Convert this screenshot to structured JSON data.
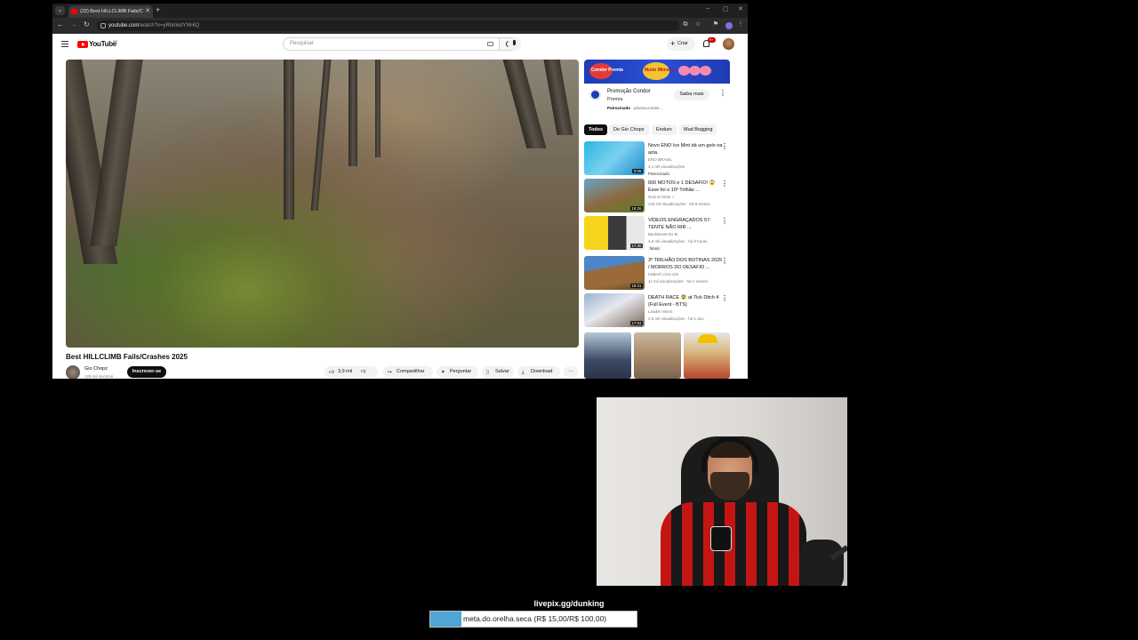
{
  "browser": {
    "tab_title": "(22) Best HILLCLIMB Fails/C",
    "new_tab": "+",
    "url_host": "youtube.com",
    "url_path": "/watch?v=yRbmkdYNHiQ",
    "window_controls": [
      "–",
      "▢",
      "✕"
    ]
  },
  "youtube": {
    "logo_text": "YouTube",
    "region": "BR",
    "search_placeholder": "Pesquisar",
    "create_label": "Criar",
    "notifications_badge": "9+"
  },
  "video": {
    "title": "Best HILLCLIMB Fails/Crashes 2025",
    "channel": "Gio Chopz",
    "subscribers": "129 mil inscritos",
    "subscribe_label": "Inscrever-se",
    "likes": "3,9 mil",
    "share_label": "Compartilhar",
    "ask_label": "Perguntar",
    "save_label": "Salvar",
    "download_label": "Download",
    "more": "···"
  },
  "ad": {
    "banner_text_1": "Condor Premia",
    "banner_text_2": "Muito Mimoso",
    "name": "Promoção Condor",
    "sub": "Premia",
    "sponsored": "Patrocinado",
    "domain": "· premia.condor...",
    "cta": "Saiba mais"
  },
  "chips": [
    "Todos",
    "De Gio Chopz",
    "Enduro",
    "Mud Bogging"
  ],
  "recommendations": [
    {
      "title": "Novo ENO Ice Mint dá um gelo na azia.",
      "channel": "ENO BRASIL",
      "meta": "4,1 mil visualizações",
      "badge": "Patrocinado",
      "duration": "0:06"
    },
    {
      "title": "600 MOTOS e 1 DESAFIO! 😱 Esse foi o 10º Trilhão ...",
      "channel": "Nois te trinte ✓",
      "meta": "142 mil visualizações · há 8 meses",
      "badge": "",
      "duration": "19:26"
    },
    {
      "title": "VÍDEOS ENGRAÇADOS 57: TENTE NÃO RIR ...",
      "channel": "Backstreet Do Bi",
      "meta": "4,9 mil visualizações · há 6 horas",
      "badge": "Novo",
      "duration": "17:30"
    },
    {
      "title": "3º TRILHÃO DOS BOTINAS 2025 / MORROS DO DESAFIO ...",
      "channel": "Haberé Lima 222",
      "meta": "11 mil visualizações · há 2 meses",
      "badge": "",
      "duration": "18:31"
    },
    {
      "title": "DEATH RACE 😨 at Tick Ditch 4 (Full Event - BTS)",
      "channel": "Leader Vision",
      "meta": "2,6 mil visualizações · há 1 ano",
      "badge": "",
      "duration": "17:04"
    }
  ],
  "overlay": {
    "livepix": "livepix.gg/dunking",
    "goal_text": "meta.do.orelha.seca (R$ 15,00/R$ 100,00)",
    "goal_progress": 0.15
  },
  "colors": {
    "yt_red": "#ff0000",
    "goal_fill": "#4fa6d6",
    "ad_blue": "#1d3bb3"
  }
}
